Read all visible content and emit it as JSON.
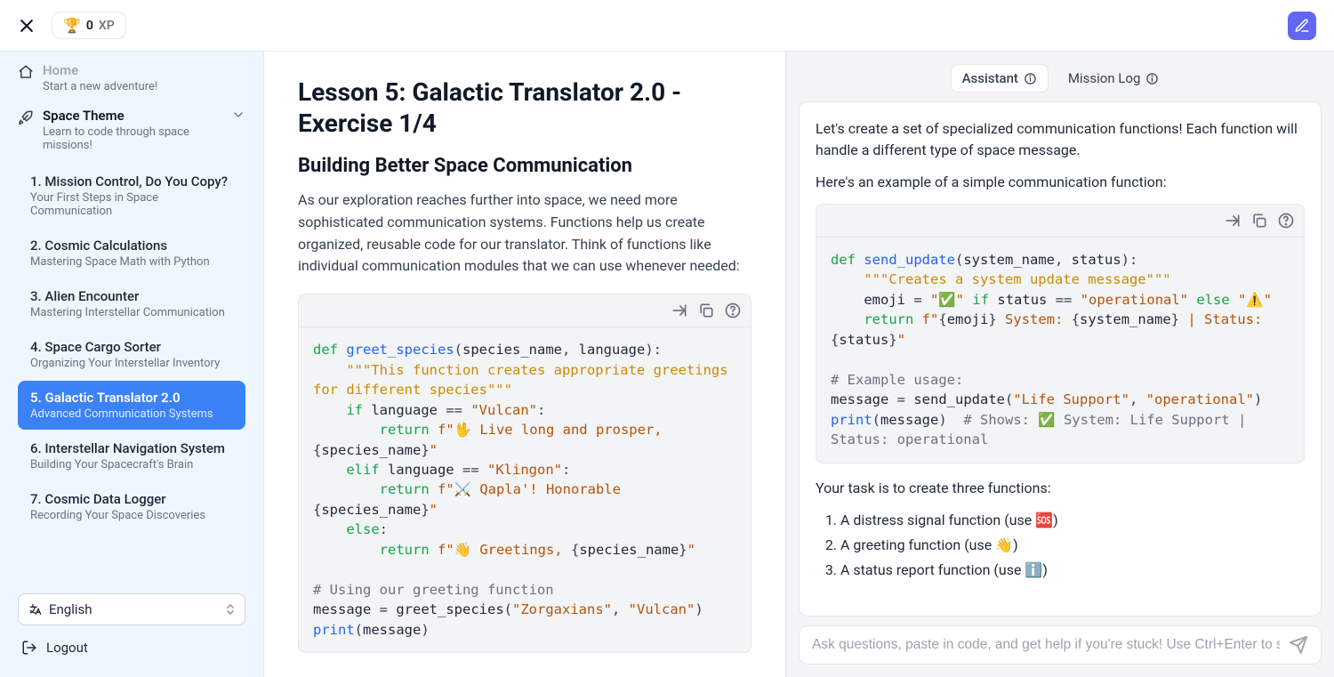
{
  "topbar": {
    "xp_value": "0",
    "xp_label": "XP"
  },
  "sidebar": {
    "home": {
      "title": "Home",
      "sub": "Start a new adventure!"
    },
    "theme": {
      "title": "Space Theme",
      "sub": "Learn to code through space missions!"
    },
    "lessons": [
      {
        "title": "1. Mission Control, Do You Copy?",
        "sub": "Your First Steps in Space Communication"
      },
      {
        "title": "2. Cosmic Calculations",
        "sub": "Mastering Space Math with Python"
      },
      {
        "title": "3. Alien Encounter",
        "sub": "Mastering Interstellar Communication"
      },
      {
        "title": "4. Space Cargo Sorter",
        "sub": "Organizing Your Interstellar Inventory"
      },
      {
        "title": "5. Galactic Translator 2.0",
        "sub": "Advanced Communication Systems"
      },
      {
        "title": "6. Interstellar Navigation System",
        "sub": "Building Your Spacecraft's Brain"
      },
      {
        "title": "7. Cosmic Data Logger",
        "sub": "Recording Your Space Discoveries"
      }
    ],
    "language": "English",
    "logout": "Logout"
  },
  "lesson": {
    "title": "Lesson 5: Galactic Translator 2.0 - Exercise 1/4",
    "subtitle": "Building Better Space Communication",
    "para": "As our exploration reaches further into space, we need more sophisticated communication systems. Functions help us create organized, reusable code for our translator. Think of functions like individual communication modules that we can use whenever needed:",
    "code": {
      "raw": "def greet_species(species_name, language):\n    \"\"\"This function creates appropriate greetings for different species\"\"\"\n    if language == \"Vulcan\":\n        return f\"🖖 Live long and prosper, {species_name}\"\n    elif language == \"Klingon\":\n        return f\"⚔️ Qapla'! Honorable {species_name}\"\n    else:\n        return f\"👋 Greetings, {species_name}\"\n\n# Using our greeting function\nmessage = greet_species(\"Zorgaxians\", \"Vulcan\")\nprint(message)"
    }
  },
  "right": {
    "tabs": {
      "assistant": "Assistant",
      "missionlog": "Mission Log"
    },
    "msg1": "Let's create a set of specialized communication functions! Each function will handle a different type of space message.",
    "msg2": "Here's an example of a simple communication function:",
    "code": {
      "raw": "def send_update(system_name, status):\n    \"\"\"Creates a system update message\"\"\"\n    emoji = \"✅\" if status == \"operational\" else \"⚠️\"\n    return f\"{emoji} System: {system_name} | Status: {status}\"\n\n# Example usage:\nmessage = send_update(\"Life Support\", \"operational\")\nprint(message)  # Shows: ✅ System: Life Support | Status: operational"
    },
    "taskintro": "Your task is to create three functions:",
    "tasks": [
      "A distress signal function (use 🆘)",
      "A greeting function (use 👋)",
      "A status report function (use ℹ️)"
    ],
    "placeholder": "Ask questions, paste in code, and get help if you're stuck! Use Ctrl+Enter to send."
  }
}
